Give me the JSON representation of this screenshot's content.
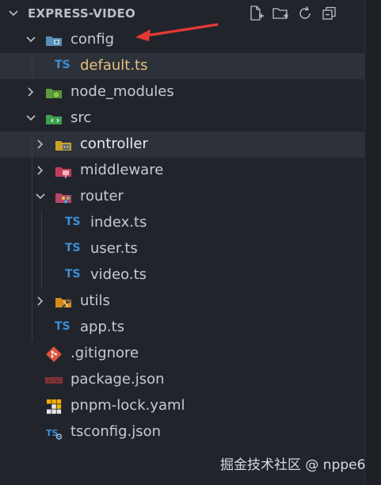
{
  "explorer": {
    "title": "EXPRESS-VIDEO",
    "actions": [
      {
        "icon": "new-file-icon"
      },
      {
        "icon": "new-folder-icon"
      },
      {
        "icon": "refresh-icon"
      },
      {
        "icon": "collapse-all-icon"
      }
    ]
  },
  "tree": {
    "config": "config",
    "default_ts": "default.ts",
    "node_modules": "node_modules",
    "src": "src",
    "controller": "controller",
    "middleware": "middleware",
    "router": "router",
    "index_ts": "index.ts",
    "user_ts": "user.ts",
    "video_ts": "video.ts",
    "utils": "utils",
    "app_ts": "app.ts",
    "gitignore": ".gitignore",
    "package_json": "package.json",
    "pnpm_lock": "pnpm-lock.yaml",
    "tsconfig": "tsconfig.json"
  },
  "ts_badge": "TS",
  "colors": {
    "background": "#21252b",
    "open_file": "#e5c07b",
    "ts_blue": "#3d8fd6",
    "annotation_arrow": "#e53935"
  },
  "watermark": "掘金技术社区 @ nppe6"
}
